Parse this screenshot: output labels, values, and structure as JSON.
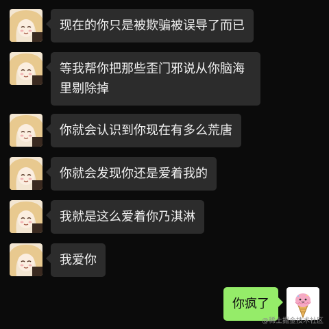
{
  "colors": {
    "background": "#0b0b0b",
    "incoming_bubble": "#2c2c2c",
    "outgoing_bubble": "#95ec69"
  },
  "messages": [
    {
      "sender": "other",
      "text": "现在的你只是被欺骗被误导了而已"
    },
    {
      "sender": "other",
      "text": "等我帮你把那些歪门邪说从你脑海里剔除掉"
    },
    {
      "sender": "other",
      "text": "你就会认识到你现在有多么荒唐"
    },
    {
      "sender": "other",
      "text": "你就会发现你还是爱着我的"
    },
    {
      "sender": "other",
      "text": "我就是这么爱着你乃淇淋"
    },
    {
      "sender": "other",
      "text": "我爱你"
    },
    {
      "sender": "me",
      "text": "你疯了"
    }
  ],
  "avatars": {
    "other": "anime-girl-avatar-icon",
    "me": "ice-cream-avatar-icon"
  },
  "watermark": "@稀土掘金技术社区"
}
